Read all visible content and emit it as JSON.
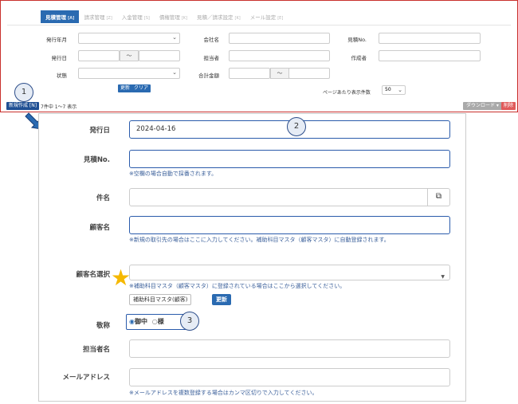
{
  "tabs": [
    {
      "label": "見積管理",
      "hotkey": "[A]",
      "active": true
    },
    {
      "label": "請求管理",
      "hotkey": "[Z]",
      "active": false
    },
    {
      "label": "入金管理",
      "hotkey": "[S]",
      "active": false
    },
    {
      "label": "債権管理",
      "hotkey": "[K]",
      "active": false
    },
    {
      "label": "見積／請求設定",
      "hotkey": "[K]",
      "active": false
    },
    {
      "label": "メール設定",
      "hotkey": "[E]",
      "active": false
    }
  ],
  "filters": {
    "issue_month": "発行年月",
    "company_name": "会社名",
    "quote_no": "見積No.",
    "issue_date": "発行日",
    "tilde": "～",
    "person_in_charge": "担当者",
    "creator": "作成者",
    "status": "状態",
    "total_amount": "合計金額",
    "update_btn": "更新",
    "clear_btn": "クリア",
    "per_page_label": "ページあたり表示件数",
    "per_page_value": "50"
  },
  "toolbar": {
    "new_btn": "新規作成 [N]",
    "count_text": "7件中 1〜7 表示",
    "download_btn": "ダウンロード ▾",
    "delete_btn": "削除"
  },
  "callouts": {
    "one": "1",
    "two": "2",
    "three": "3"
  },
  "form": {
    "issue_date_label": "発行日",
    "issue_date_value": "2024-04-16",
    "quote_no_label": "見積No.",
    "quote_no_hint": "※空欄の場合自動で採番されます。",
    "subject_label": "件名",
    "customer_label": "顧客名",
    "customer_hint": "※新規の取引先の場合はここに入力してください。補助科目マスタ（顧客マスタ）に自動登録されます。",
    "customer_select_label": "顧客名選択",
    "customer_select_hint": "※補助科目マスタ（顧客マスタ）に登録されている場合はここから選択してください。",
    "master_btn": "補助科目マスタ(顧客)",
    "refresh_btn": "更新",
    "honorific_label": "敬称",
    "honorific_opt1": "御中",
    "honorific_opt2": "様",
    "contact_label": "担当者名",
    "email_label": "メールアドレス",
    "email_hint": "※メールアドレスを複数登録する場合はカンマ区切りで入力してください。"
  },
  "colors": {
    "brand": "#2a6ab1",
    "accent_border": "#2a5bab",
    "star": "#f5b800",
    "delete": "#e05b5b"
  }
}
